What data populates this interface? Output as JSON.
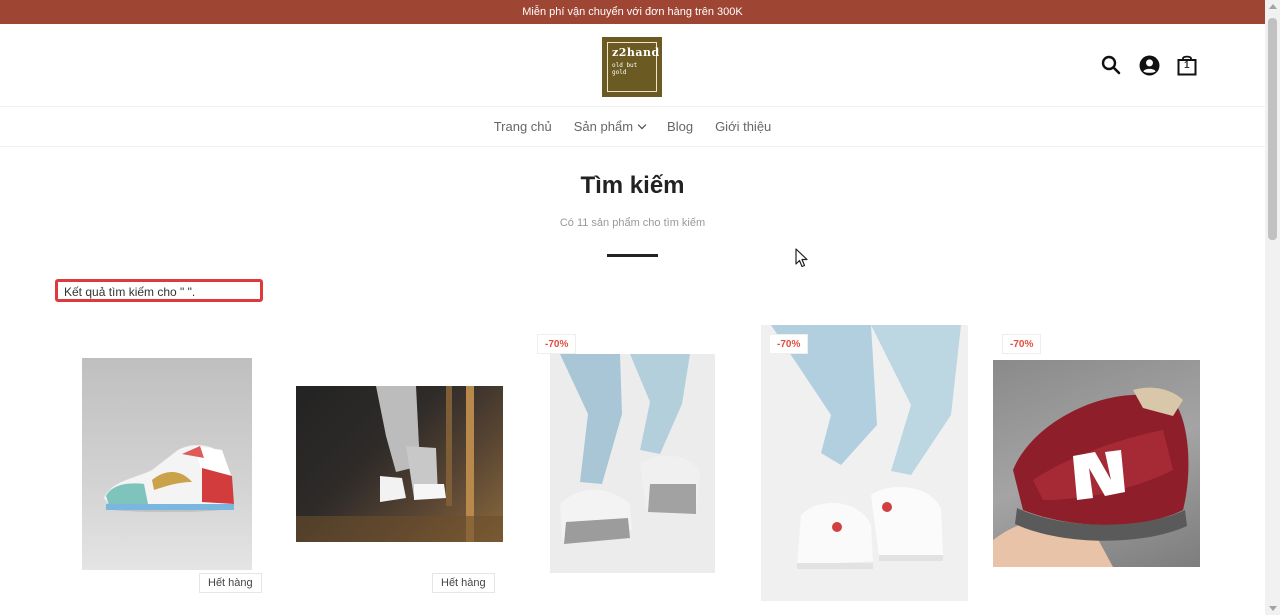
{
  "announcement": "Miễn phí vận chuyển với đơn hàng trên 300K",
  "logo": {
    "brand": "z2hand",
    "tagline_1": "old but",
    "tagline_2": "gold"
  },
  "header_icons": [
    "search-icon",
    "user-icon",
    "cart-icon"
  ],
  "cart_count": "1",
  "nav": [
    {
      "label": "Trang chủ"
    },
    {
      "label": "Sản phẩm",
      "has_dropdown": true
    },
    {
      "label": "Blog"
    },
    {
      "label": "Giới thiệu"
    }
  ],
  "page": {
    "title": "Tìm kiếm",
    "subtitle": "Có 11 sản phẩm cho tìm kiếm",
    "results_label": "Kết quả tìm kiếm cho \" \"."
  },
  "products": [
    {
      "image": "sneaker-high-top-white-red-teal",
      "badge": "",
      "status": "Hết hàng"
    },
    {
      "image": "white-sneaker-grey-pants",
      "badge": "",
      "status": "Hết hàng"
    },
    {
      "image": "grey-white-chunky-sneaker",
      "badge": "-70%",
      "status": ""
    },
    {
      "image": "white-sneaker-light-jeans",
      "badge": "-70%",
      "status": ""
    },
    {
      "image": "red-new-balance-sneaker",
      "badge": "-70%",
      "status": ""
    }
  ],
  "colors": {
    "announcement_bg": "#9f4534",
    "logo_bg": "#6b5a21",
    "badge_text": "#e24d40",
    "highlight_border": "#e0393b"
  }
}
